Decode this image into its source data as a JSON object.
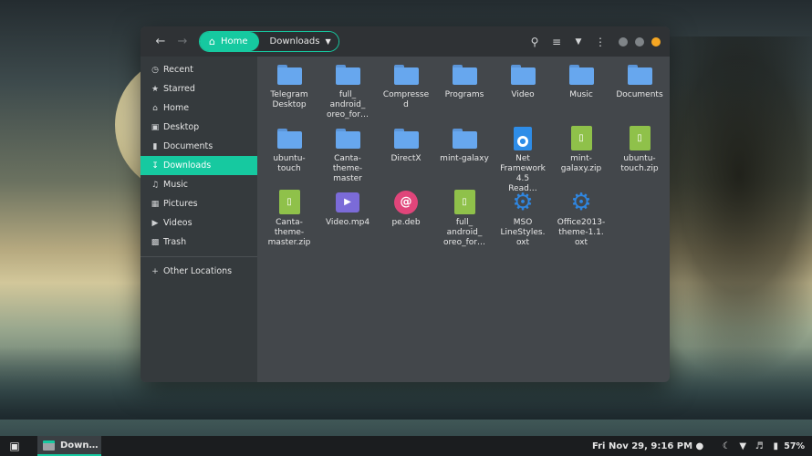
{
  "desktop": {
    "accent": "#16c9a0"
  },
  "headerbar": {
    "back_icon": "back-arrow-icon",
    "forward_icon": "forward-arrow-icon",
    "path": {
      "home_label": "Home",
      "current_label": "Downloads"
    },
    "icons": [
      "search-icon",
      "view-list-icon",
      "sort-dropdown-icon",
      "menu-kebab-icon"
    ],
    "window_controls": [
      {
        "name": "minimize",
        "color": "#7f8488"
      },
      {
        "name": "maximize",
        "color": "#7f8488"
      },
      {
        "name": "close",
        "color": "#f5a623"
      }
    ]
  },
  "sidebar": {
    "items": [
      {
        "label": "Recent",
        "icon": "clock-icon"
      },
      {
        "label": "Starred",
        "icon": "star-icon"
      },
      {
        "label": "Home",
        "icon": "home-icon"
      },
      {
        "label": "Desktop",
        "icon": "desktop-icon"
      },
      {
        "label": "Documents",
        "icon": "document-icon"
      },
      {
        "label": "Downloads",
        "icon": "download-icon",
        "active": true
      },
      {
        "label": "Music",
        "icon": "music-icon"
      },
      {
        "label": "Pictures",
        "icon": "picture-icon"
      },
      {
        "label": "Videos",
        "icon": "video-icon"
      },
      {
        "label": "Trash",
        "icon": "trash-icon"
      }
    ],
    "other": {
      "label": "Other Locations",
      "icon": "plus-icon"
    }
  },
  "files": [
    {
      "label": "Telegram Desktop",
      "type": "folder"
    },
    {
      "label": "full_ android_ oreo_for…",
      "type": "folder"
    },
    {
      "label": "Compresse d",
      "type": "folder"
    },
    {
      "label": "Programs",
      "type": "folder"
    },
    {
      "label": "Video",
      "type": "folder"
    },
    {
      "label": "Music",
      "type": "folder"
    },
    {
      "label": "Documents",
      "type": "folder"
    },
    {
      "label": "ubuntu- touch",
      "type": "folder"
    },
    {
      "label": "Canta- theme- master",
      "type": "folder"
    },
    {
      "label": "DirectX",
      "type": "folder"
    },
    {
      "label": "mint-galaxy",
      "type": "folder"
    },
    {
      "label": "Net Framework 4.5 Read…",
      "type": "netdoc"
    },
    {
      "label": "mint- galaxy.zip",
      "type": "zip"
    },
    {
      "label": "ubuntu- touch.zip",
      "type": "zip"
    },
    {
      "label": "Canta- theme- master.zip",
      "type": "zip"
    },
    {
      "label": "Video.mp4",
      "type": "video"
    },
    {
      "label": "pe.deb",
      "type": "deb"
    },
    {
      "label": "full_ android_ oreo_for…",
      "type": "zip"
    },
    {
      "label": "MSO LineStyles. oxt",
      "type": "extension"
    },
    {
      "label": "Office2013- theme-1.1. oxt",
      "type": "extension"
    }
  ],
  "taskbar": {
    "task_label": "Down…",
    "clock": "Fri Nov 29,  9:16 PM ●",
    "battery": "57%",
    "tray_icons": [
      "night-mode-icon",
      "wifi-icon",
      "volume-icon",
      "battery-icon"
    ]
  }
}
